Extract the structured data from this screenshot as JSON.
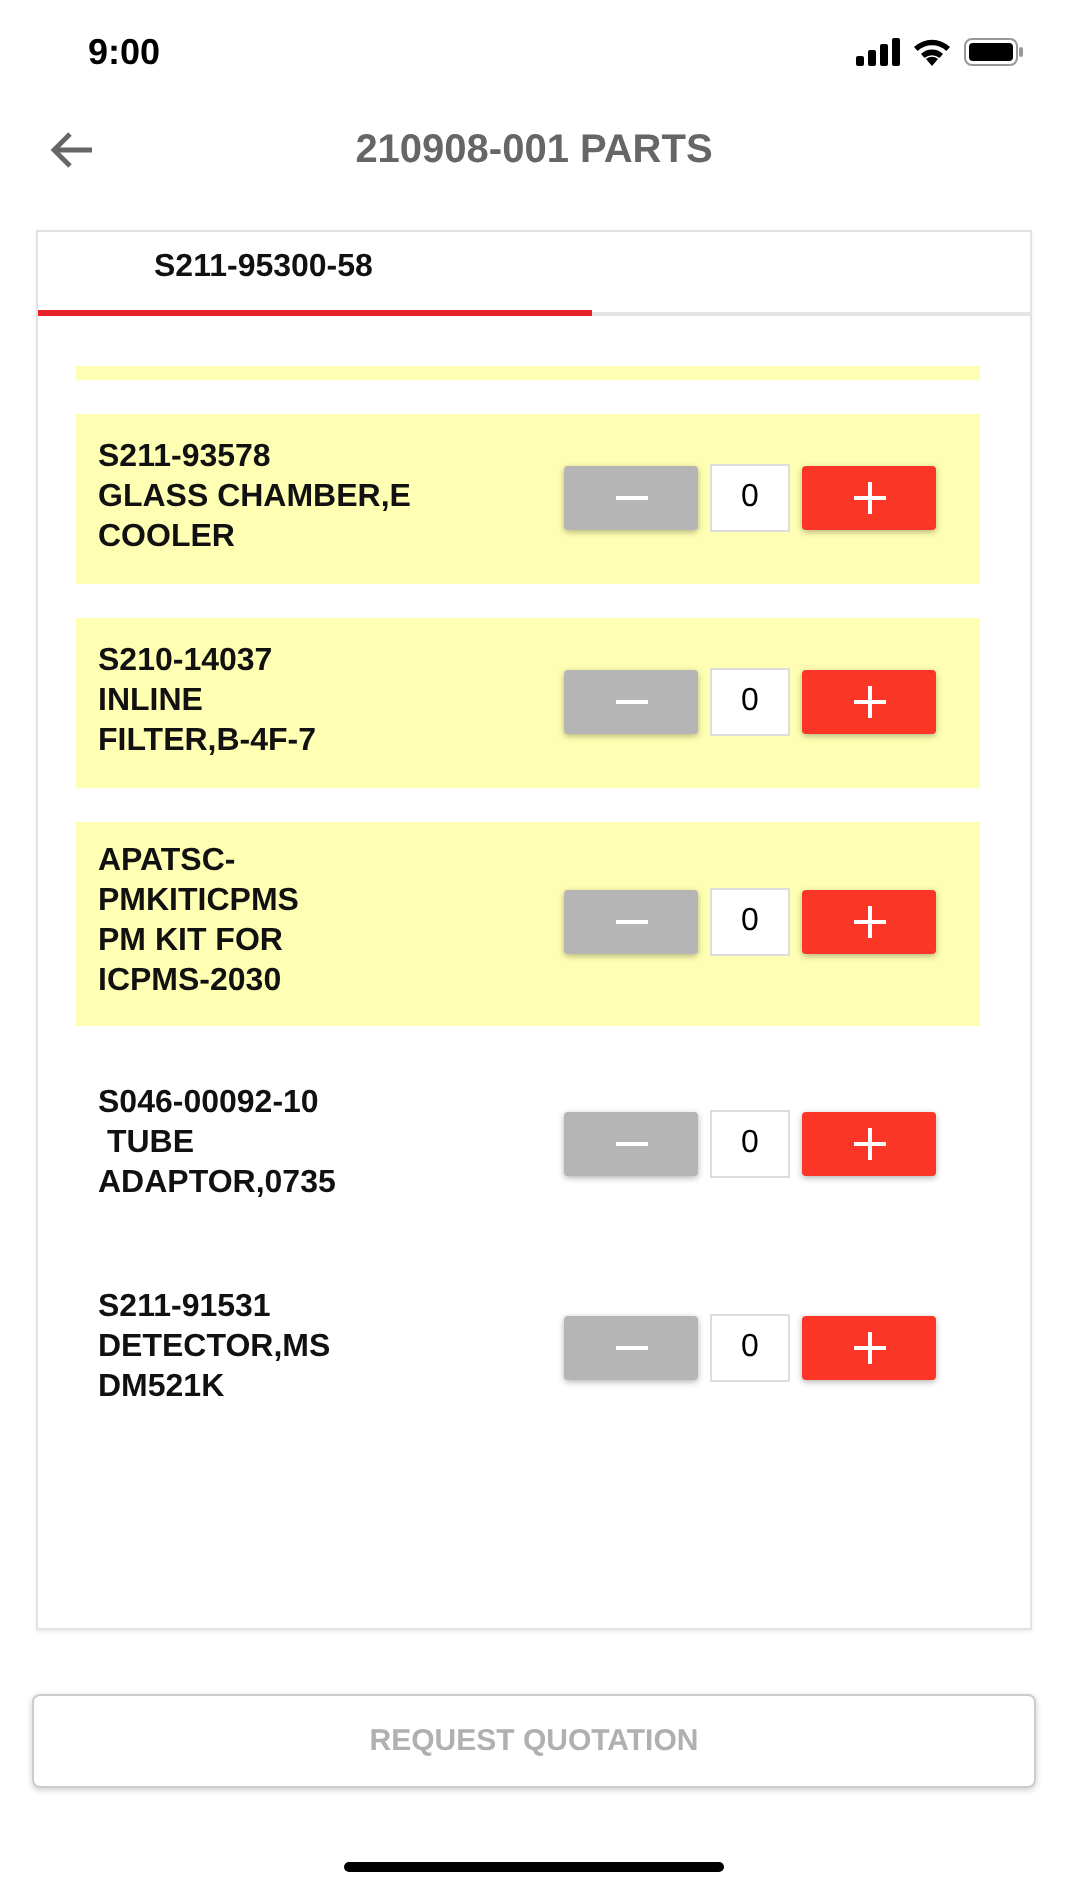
{
  "status_bar": {
    "time": "9:00"
  },
  "header": {
    "title": "210908-001 PARTS"
  },
  "tabs": [
    {
      "label": "S211-95300-58",
      "selected": true
    }
  ],
  "parts": [
    {
      "text": "S211-93578\nGLASS CHAMBER,E\nCOOLER",
      "highlighted": true,
      "quantity": "0",
      "minus_disabled": true
    },
    {
      "text": "S210-14037\nINLINE\nFILTER,B-4F-7",
      "highlighted": true,
      "quantity": "0",
      "minus_disabled": true
    },
    {
      "text": "APATSC-\nPMKITICPMS\nPM KIT FOR\nICPMS-2030",
      "highlighted": true,
      "quantity": "0",
      "minus_disabled": true
    },
    {
      "text": "S046-00092-10\n TUBE\nADAPTOR,0735",
      "highlighted": false,
      "quantity": "0",
      "minus_disabled": true
    },
    {
      "text": "S211-91531\nDETECTOR,MS\nDM521K",
      "highlighted": false,
      "quantity": "0",
      "minus_disabled": true
    }
  ],
  "footer": {
    "button": "REQUEST QUOTATION",
    "disabled": true
  }
}
